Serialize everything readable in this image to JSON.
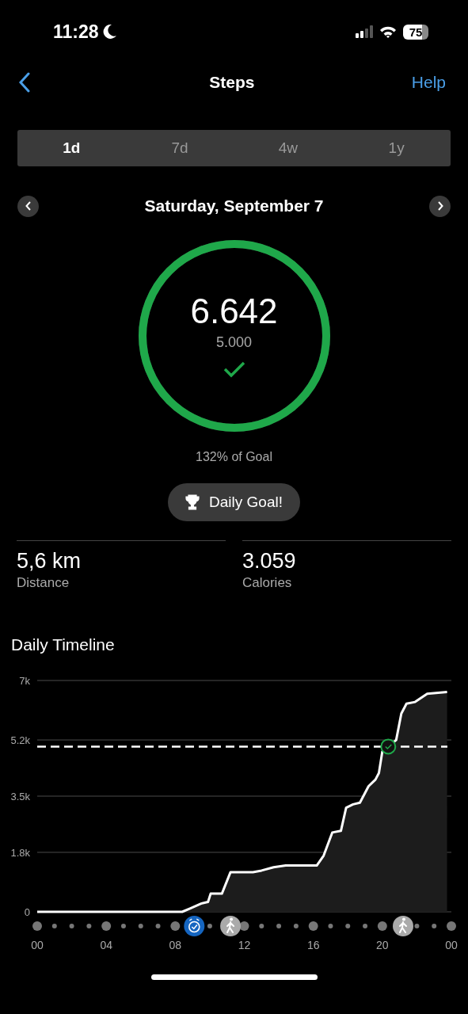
{
  "status_bar": {
    "time": "11:28",
    "battery": "75"
  },
  "nav": {
    "title": "Steps",
    "action": "Help"
  },
  "tabs": [
    {
      "label": "1d",
      "selected": true
    },
    {
      "label": "7d",
      "selected": false
    },
    {
      "label": "4w",
      "selected": false
    },
    {
      "label": "1y",
      "selected": false
    }
  ],
  "date": "Saturday, September 7",
  "goal": {
    "steps": "6.642",
    "target": "5.000",
    "level": 1,
    "achieved": true,
    "percent": "132% of Goal",
    "badge": "Daily Goal!"
  },
  "stats": [
    {
      "value": "5,6 km",
      "label": "Distance"
    },
    {
      "value": "3.059",
      "label": "Calories"
    }
  ],
  "timeline": {
    "title": "Daily Timeline",
    "goal_reached": true,
    "markers": [
      {
        "kind": "timer"
      },
      {
        "kind": "walk"
      },
      {
        "kind": "walk"
      }
    ],
    "chart_data": {
      "type": "area",
      "grid": true,
      "x": [
        0,
        3,
        3.2,
        8.4,
        8.85,
        9.5,
        9.9,
        10.05,
        10.7,
        11.2,
        11.6,
        12.5,
        13,
        13.7,
        14.4,
        16.2,
        16.6,
        17.1,
        17.6,
        17.9,
        18.3,
        18.7,
        19.2,
        19.6,
        19.8,
        20,
        20.8,
        21.1,
        21.4,
        21.9,
        22.6,
        23.75
      ],
      "series": [
        {
          "color": "#ffffff",
          "values": [
            0,
            0,
            0,
            0,
            100,
            250,
            300,
            550,
            550,
            1200,
            1200,
            1200,
            1250,
            1350,
            1400,
            1400,
            1700,
            2400,
            2450,
            3150,
            3250,
            3300,
            3800,
            4000,
            4200,
            4850,
            5200,
            6000,
            6300,
            6350,
            6600,
            6650
          ]
        }
      ],
      "xlim": [
        0,
        24
      ],
      "ylim": [
        0,
        7000
      ],
      "xticks": [
        {
          "value": 0,
          "label": "00"
        },
        {
          "value": 4,
          "label": "04"
        },
        {
          "value": 8,
          "label": "08"
        },
        {
          "value": 12,
          "label": "12"
        },
        {
          "value": 16,
          "label": "16"
        },
        {
          "value": 20,
          "label": "20"
        },
        {
          "value": 24,
          "label": "00"
        }
      ],
      "yticks": [
        {
          "value": 0,
          "label": "0"
        },
        {
          "value": 1800,
          "label": "1.8k"
        },
        {
          "value": 3500,
          "label": "3.5k"
        },
        {
          "value": 5200,
          "label": "5.2k"
        },
        {
          "value": 7000,
          "label": "7k"
        }
      ],
      "ref_lines": [
        {
          "axis": "y",
          "value": 5000
        }
      ]
    }
  }
}
